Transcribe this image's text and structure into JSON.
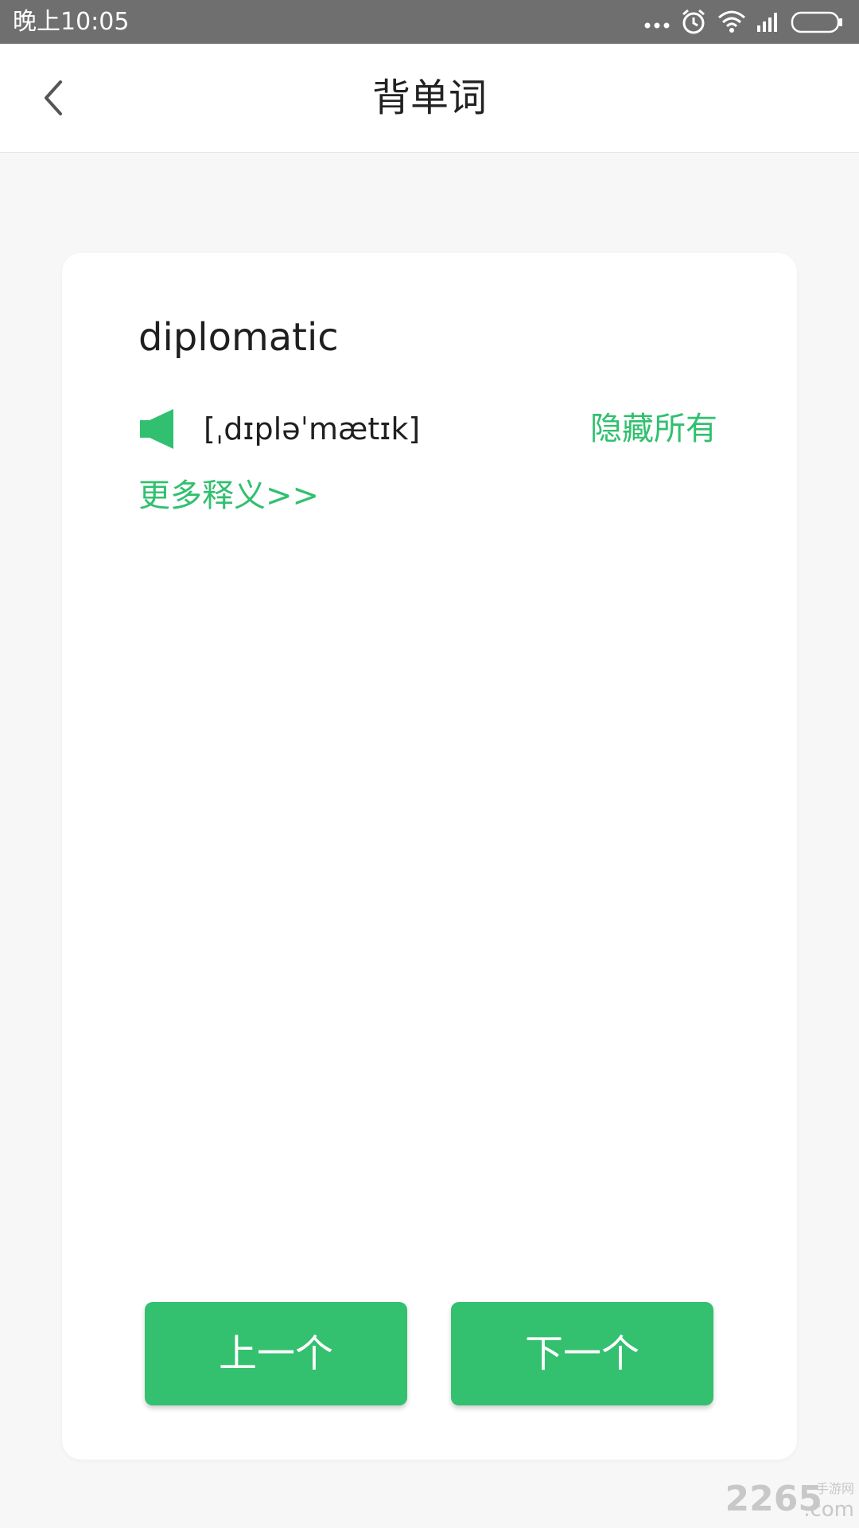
{
  "status_bar": {
    "time": "晚上10:05",
    "icons": [
      "more-dots-icon",
      "alarm-icon",
      "wifi-icon",
      "signal-icon",
      "battery-icon"
    ]
  },
  "header": {
    "title": "背单词",
    "back_icon": "chevron-left-icon"
  },
  "card": {
    "word": "diplomatic",
    "phonetic": "[ˌdɪpləˈmætɪk]",
    "speaker_icon": "speaker-icon",
    "hide_all_label": "隐藏所有",
    "more_meanings_label": "更多释义>>",
    "prev_button_label": "上一个",
    "next_button_label": "下一个"
  },
  "watermark": {
    "text": "2265",
    "sub_text": "手游网",
    "domain": ".com"
  },
  "colors": {
    "accent": "#31c06f",
    "status_bar": "#6f6f6f",
    "background": "#f7f7f7"
  }
}
